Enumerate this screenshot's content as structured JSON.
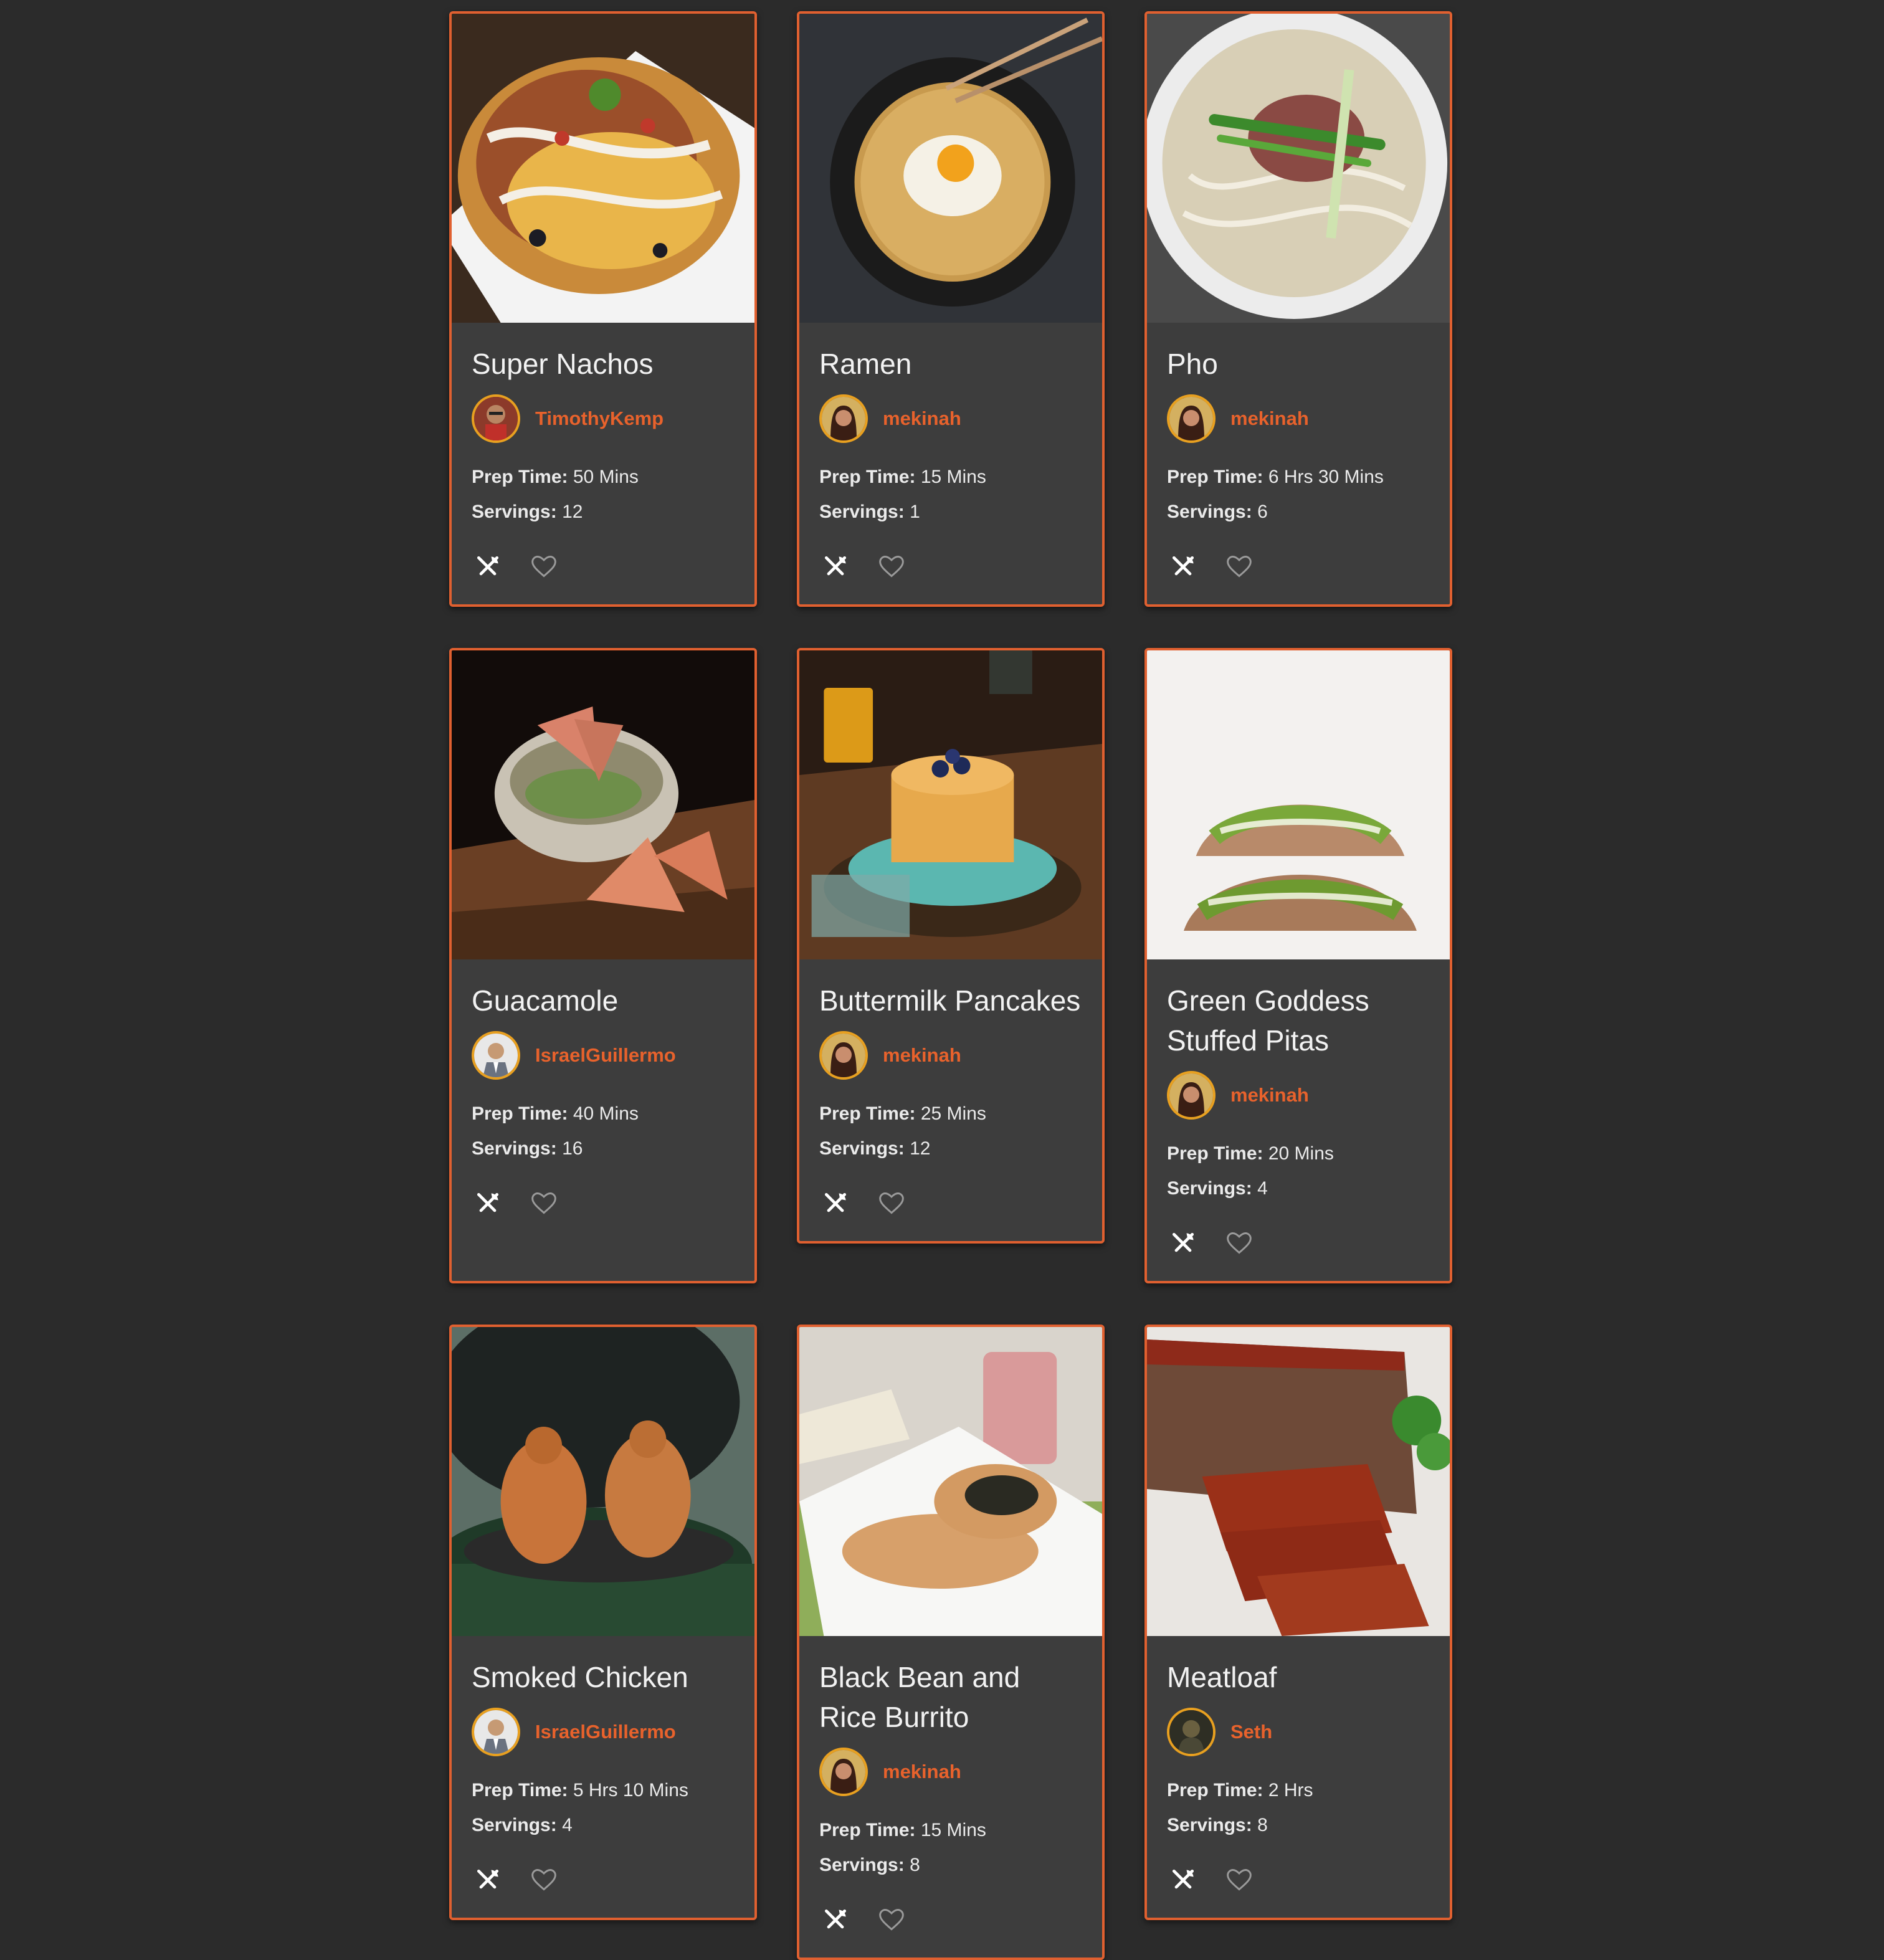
{
  "labels": {
    "prep": "Prep Time:",
    "servings": "Servings:"
  },
  "theme": {
    "accent": "#e8622c",
    "border": "#e06030",
    "card": "#3d3d3d",
    "background": "#2b2b2b"
  },
  "recipes": [
    {
      "title": "Super Nachos",
      "author": "TimothyKemp",
      "prep": "50 Mins",
      "servings": "12"
    },
    {
      "title": "Ramen",
      "author": "mekinah",
      "prep": "15 Mins",
      "servings": "1"
    },
    {
      "title": "Pho",
      "author": "mekinah",
      "prep": "6 Hrs 30 Mins",
      "servings": "6"
    },
    {
      "title": "Guacamole",
      "author": "IsraelGuillermo",
      "prep": "40 Mins",
      "servings": "16"
    },
    {
      "title": "Buttermilk Pancakes",
      "author": "mekinah",
      "prep": "25 Mins",
      "servings": "12"
    },
    {
      "title": "Green Goddess Stuffed Pitas",
      "author": "mekinah",
      "prep": "20 Mins",
      "servings": "4"
    },
    {
      "title": "Smoked Chicken",
      "author": "IsraelGuillermo",
      "prep": "5 Hrs 10 Mins",
      "servings": "4"
    },
    {
      "title": "Black Bean and Rice Burrito",
      "author": "mekinah",
      "prep": "15 Mins",
      "servings": "8"
    },
    {
      "title": "Meatloaf",
      "author": "Seth",
      "prep": "2 Hrs",
      "servings": "8"
    }
  ]
}
